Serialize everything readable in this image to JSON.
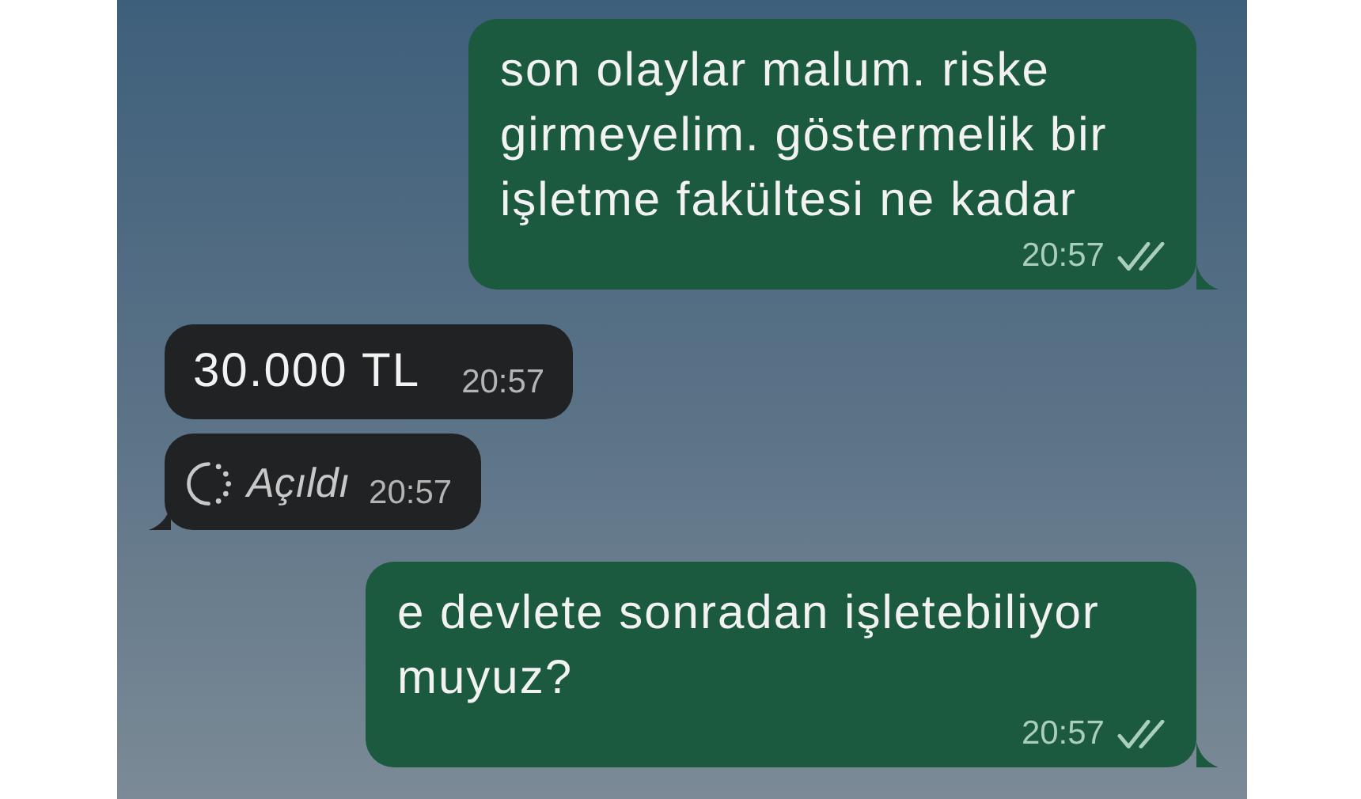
{
  "messages": [
    {
      "kind": "text",
      "outgoing": true,
      "text": "son olaylar malum. riske girmeyelim. göstermelik bir işletme fakültesi ne kadar",
      "time": "20:57",
      "read": true,
      "tail": true
    },
    {
      "kind": "text",
      "outgoing": false,
      "text": "30.000 TL",
      "time": "20:57",
      "read": false,
      "tail": false
    },
    {
      "kind": "view_once",
      "outgoing": false,
      "text": "Açıldı",
      "time": "20:57",
      "read": false,
      "tail": true
    },
    {
      "kind": "text",
      "outgoing": true,
      "text": "e devlete sonradan işletebiliyor muyuz?",
      "time": "20:57",
      "read": true,
      "tail": true
    }
  ]
}
